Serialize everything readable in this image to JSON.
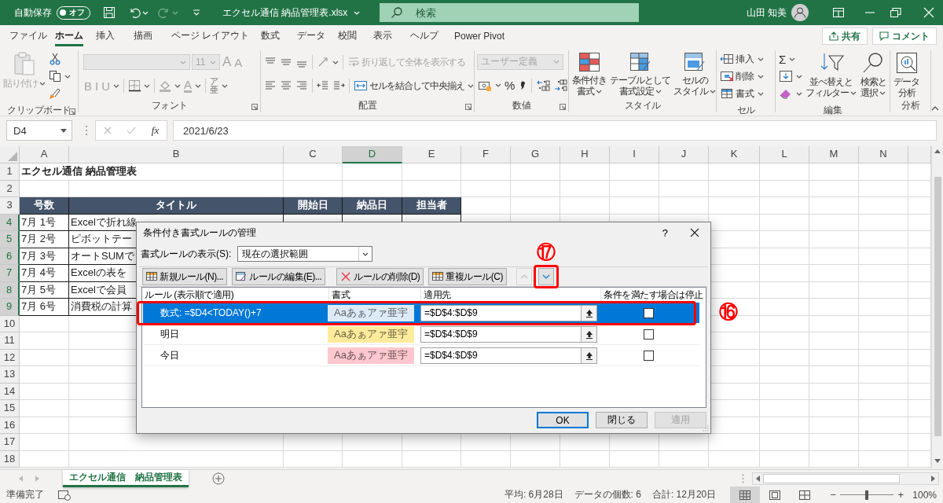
{
  "title_bar": {
    "autosave_label": "自動保存",
    "autosave_state": "オフ",
    "autosave_on": false,
    "filename": "エクセル通信 納品管理表.xlsx",
    "search_placeholder": "検索",
    "user_name": "山田 知美"
  },
  "ribbon_tabs": [
    {
      "label": "ファイル",
      "selected": false
    },
    {
      "label": "ホーム",
      "selected": true
    },
    {
      "label": "挿入",
      "selected": false
    },
    {
      "label": "描画",
      "selected": false
    },
    {
      "label": "ページ レイアウト",
      "selected": false
    },
    {
      "label": "数式",
      "selected": false
    },
    {
      "label": "データ",
      "selected": false
    },
    {
      "label": "校閲",
      "selected": false
    },
    {
      "label": "表示",
      "selected": false
    },
    {
      "label": "ヘルプ",
      "selected": false
    },
    {
      "label": "Power Pivot",
      "selected": false
    }
  ],
  "share_button": "共有",
  "comment_button": "コメント",
  "ribbon": {
    "clipboard": {
      "label": "クリップボード",
      "paste": "貼り付け"
    },
    "font": {
      "label": "フォント",
      "size": "11",
      "grow": "A",
      "shrink": "A",
      "bold": "B",
      "italic": "I",
      "underline": "U",
      "font_color": "A",
      "phonetic_top": "ア",
      "phonetic_bottom": "亜"
    },
    "alignment": {
      "label": "配置",
      "wrap_text": "折り返して全体を表示する",
      "merge_center": "セルを結合して中央揃え"
    },
    "number": {
      "label": "数値",
      "format": "ユーザー定義",
      "percent": "%"
    },
    "styles": {
      "label": "スタイル",
      "buttons": [
        {
          "kind": "conditional",
          "lines": [
            "条件付き",
            "書式"
          ]
        },
        {
          "kind": "table",
          "lines": [
            "テーブルとして",
            "書式設定"
          ]
        },
        {
          "kind": "cell_styles",
          "lines": [
            "セルの",
            "スタイル"
          ]
        }
      ]
    },
    "cells": {
      "label": "セル",
      "buttons": [
        {
          "kind": "insert",
          "label": "挿入"
        },
        {
          "kind": "delete",
          "label": "削除"
        },
        {
          "kind": "format",
          "label": "書式"
        }
      ]
    },
    "editing": {
      "label": "編集",
      "sum": "Σ",
      "buttons": [
        {
          "kind": "sort",
          "lines": [
            "並べ替えと",
            "フィルター"
          ]
        },
        {
          "kind": "find",
          "lines": [
            "検索と",
            "選択"
          ]
        }
      ]
    },
    "analysis": {
      "label": "分析",
      "buttons": [
        {
          "kind": "data_analysis",
          "lines": [
            "データ",
            "分析"
          ]
        }
      ]
    }
  },
  "formula_bar": {
    "name_box": "D4",
    "fx": "fx",
    "value": "2021/6/23"
  },
  "sheet": {
    "columns": [
      {
        "label": "A",
        "selected": false
      },
      {
        "label": "B",
        "selected": false
      },
      {
        "label": "C",
        "selected": false
      },
      {
        "label": "D",
        "selected": true
      },
      {
        "label": "E",
        "selected": false
      },
      {
        "label": "F",
        "selected": false
      },
      {
        "label": "G",
        "selected": false
      },
      {
        "label": "H",
        "selected": false
      },
      {
        "label": "I",
        "selected": false
      },
      {
        "label": "J",
        "selected": false
      },
      {
        "label": "K",
        "selected": false
      },
      {
        "label": "L",
        "selected": false
      },
      {
        "label": "M",
        "selected": false
      },
      {
        "label": "N",
        "selected": false
      }
    ],
    "rows": [
      {
        "number": "1",
        "selected": false,
        "kind": "title",
        "cells": [
          "エクセル通信 納品管理表"
        ]
      },
      {
        "number": "2",
        "selected": false
      },
      {
        "number": "3",
        "selected": false,
        "kind": "header",
        "cells": [
          "号数",
          "タイトル",
          "開始日",
          "納品日",
          "担当者"
        ]
      },
      {
        "number": "4",
        "selected": true,
        "kind": "data",
        "cells": [
          "7月 1号",
          "Excelで折れ線"
        ]
      },
      {
        "number": "5",
        "selected": true,
        "kind": "data",
        "cells": [
          "7月 2号",
          "ピボットテー"
        ]
      },
      {
        "number": "6",
        "selected": true,
        "kind": "data",
        "cells": [
          "7月 3号",
          "オートSUMで"
        ]
      },
      {
        "number": "7",
        "selected": true,
        "kind": "data",
        "cells": [
          "7月 4号",
          "Excelの表を"
        ]
      },
      {
        "number": "8",
        "selected": true,
        "kind": "data",
        "cells": [
          "7月 5号",
          "Excelで会員"
        ]
      },
      {
        "number": "9",
        "selected": true,
        "kind": "data",
        "cells": [
          "7月 6号",
          "消費税の計算"
        ]
      },
      {
        "number": "10",
        "selected": false
      },
      {
        "number": "11",
        "selected": false
      },
      {
        "number": "12",
        "selected": false
      },
      {
        "number": "13",
        "selected": false
      },
      {
        "number": "14",
        "selected": false
      },
      {
        "number": "15",
        "selected": false
      },
      {
        "number": "16",
        "selected": false
      },
      {
        "number": "17",
        "selected": false
      },
      {
        "number": "18",
        "selected": false
      }
    ]
  },
  "dialog": {
    "title": "条件付き書式ルールの管理",
    "help": "?",
    "show_label": "書式ルールの表示(S):",
    "show_value": "現在の選択範囲",
    "toolbar": [
      {
        "kind": "new",
        "label": "新規ルール(N)..."
      },
      {
        "kind": "edit",
        "label": "ルールの編集(E)..."
      },
      {
        "kind": "delete",
        "label": "ルールの削除(D)"
      },
      {
        "kind": "duplicate",
        "label": "重複ルール(C)"
      }
    ],
    "move_up_disabled": true,
    "move_down_disabled": false,
    "columns": [
      "ルール (表示順で適用)",
      "書式",
      "適用先",
      "条件を満たす場合は停止"
    ],
    "rules": [
      {
        "rule": "数式: =$D4<TODAY()+7",
        "preview": "Aaあぁアァ亜宇",
        "color": "#ddebf7",
        "applies_to": "=$D$4:$D$9",
        "stop": false,
        "selected": true
      },
      {
        "rule": "明日",
        "preview": "Aaあぁアァ亜宇",
        "color": "#ffeb9c",
        "applies_to": "=$D$4:$D$9",
        "stop": false,
        "selected": false
      },
      {
        "rule": "今日",
        "preview": "Aaあぁアァ亜宇",
        "color": "#ffc7ce",
        "applies_to": "=$D$4:$D$9",
        "stop": false,
        "selected": false
      }
    ],
    "buttons": [
      {
        "kind": "default",
        "label": "OK"
      },
      {
        "kind": "normal",
        "label": "閉じる"
      },
      {
        "kind": "disabled",
        "label": "適用"
      }
    ]
  },
  "annotations": [
    {
      "kind": "move_down",
      "label": "⑰"
    },
    {
      "kind": "rule_row",
      "label": "⑯"
    }
  ],
  "sheet_tabs": [
    {
      "label": "エクセル通信　納品管理表",
      "selected": true
    }
  ],
  "status_bar": {
    "ready": "準備完了",
    "stats": [
      "平均: 6月28日",
      "データの個数: 6",
      "合計: 12月20日"
    ],
    "view_buttons": [
      {
        "kind": "normal",
        "selected": true
      },
      {
        "kind": "page_layout",
        "selected": false
      },
      {
        "kind": "page_break",
        "selected": false
      }
    ],
    "zoom_out": "−",
    "zoom_slider": {
      "level": 0.5
    },
    "zoom_in": "+",
    "zoom": "100%"
  }
}
